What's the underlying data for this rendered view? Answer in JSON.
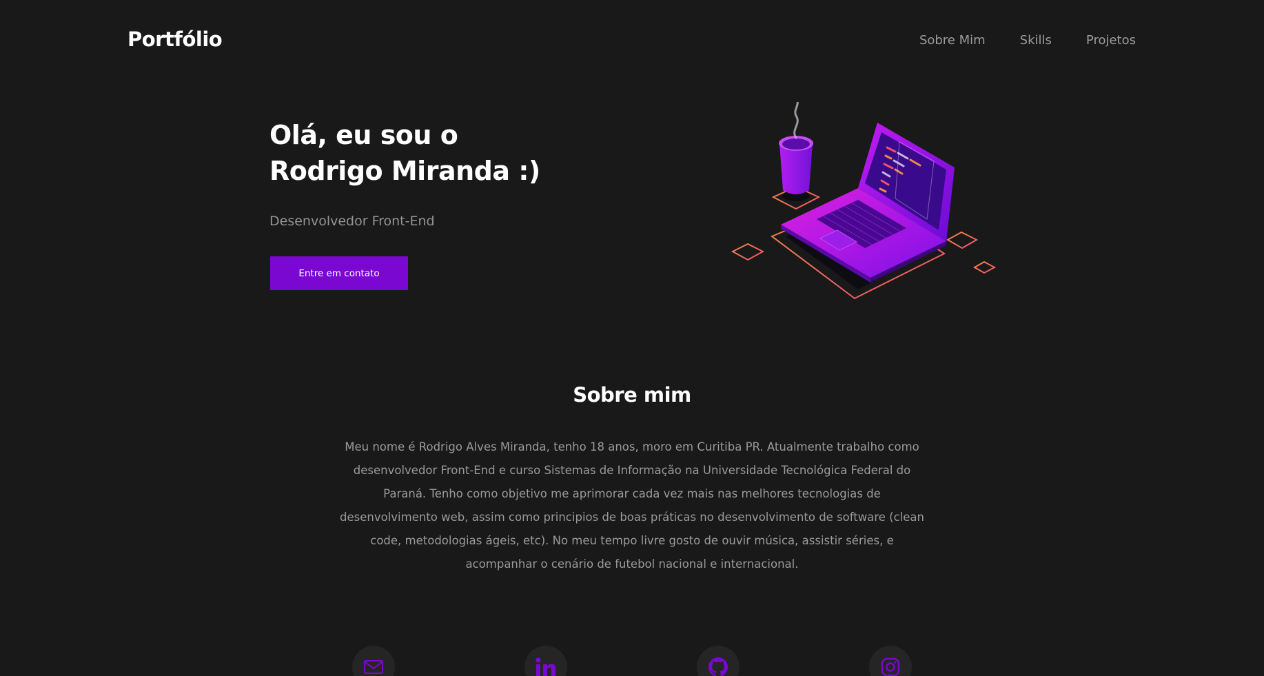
{
  "header": {
    "brand": "Portfólio",
    "nav": [
      {
        "label": "Sobre Mim"
      },
      {
        "label": "Skills"
      },
      {
        "label": "Projetos"
      }
    ]
  },
  "hero": {
    "title_line1": "Olá, eu sou o",
    "title_line2": "Rodrigo Miranda :)",
    "subtitle": "Desenvolvedor Front-End",
    "cta_label": "Entre em contato",
    "illustration_icon": "laptop-coffee-illustration"
  },
  "about": {
    "title": "Sobre mim",
    "text": "Meu nome é Rodrigo Alves Miranda, tenho 18 anos, moro em Curitiba PR. Atualmente trabalho como desenvolvedor Front-End e curso Sistemas de Informação na Universidade Tecnológica Federal do Paraná. Tenho como objetivo me aprimorar cada vez mais nas melhores tecnologias de desenvolvimento web, assim como principios de boas práticas no desenvolvimento de software (clean code, metodologias ágeis, etc). No meu tempo livre gosto de ouvir música, assistir séries, e acompanhar o cenário de futebol nacional e internacional."
  },
  "socials": [
    {
      "icon": "mail-icon"
    },
    {
      "icon": "linkedin-icon"
    },
    {
      "icon": "github-icon"
    },
    {
      "icon": "instagram-icon"
    }
  ],
  "colors": {
    "background": "#1a191a",
    "accent": "#7b08d1",
    "text_primary": "#ffffff",
    "text_muted": "#9a9a9a"
  }
}
